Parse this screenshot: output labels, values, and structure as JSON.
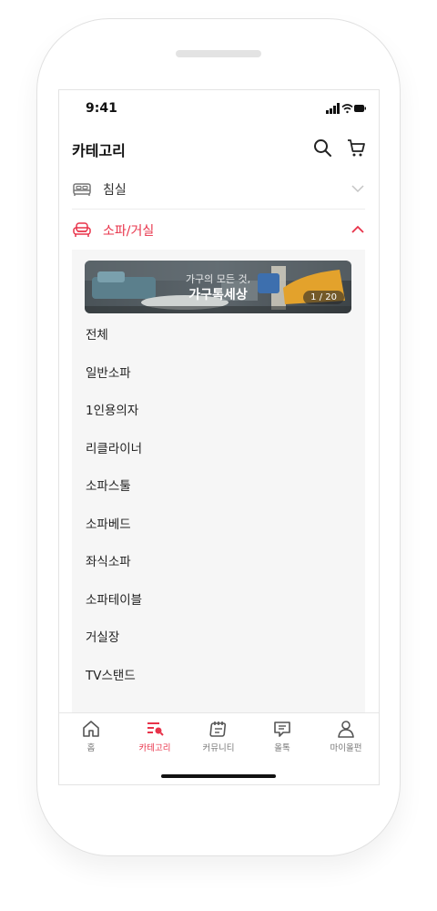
{
  "status_bar": {
    "time": "9:41"
  },
  "header": {
    "title": "카테고리"
  },
  "categories": [
    {
      "label": "침실",
      "expanded": false,
      "icon": "bed-icon"
    },
    {
      "label": "소파/거실",
      "expanded": true,
      "icon": "sofa-icon"
    }
  ],
  "banner": {
    "line1": "가구의 모든 것,",
    "line2": "가구톡세상",
    "counter": "1 / 20"
  },
  "subcategories": [
    "전체",
    "일반소파",
    "1인용의자",
    "리클라이너",
    "소파스툴",
    "소파베드",
    "좌식소파",
    "소파테이블",
    "거실장",
    "TV스탠드"
  ],
  "tabs": [
    {
      "label": "홈",
      "icon": "home-icon",
      "active": false
    },
    {
      "label": "카테고리",
      "icon": "category-search-icon",
      "active": true
    },
    {
      "label": "커뮤니티",
      "icon": "community-icon",
      "active": false
    },
    {
      "label": "올톡",
      "icon": "chat-icon",
      "active": false
    },
    {
      "label": "마이올펀",
      "icon": "person-icon",
      "active": false
    }
  ],
  "colors": {
    "accent": "#e8334a",
    "panel_bg": "#f6f6f6",
    "divider": "#ececec"
  }
}
